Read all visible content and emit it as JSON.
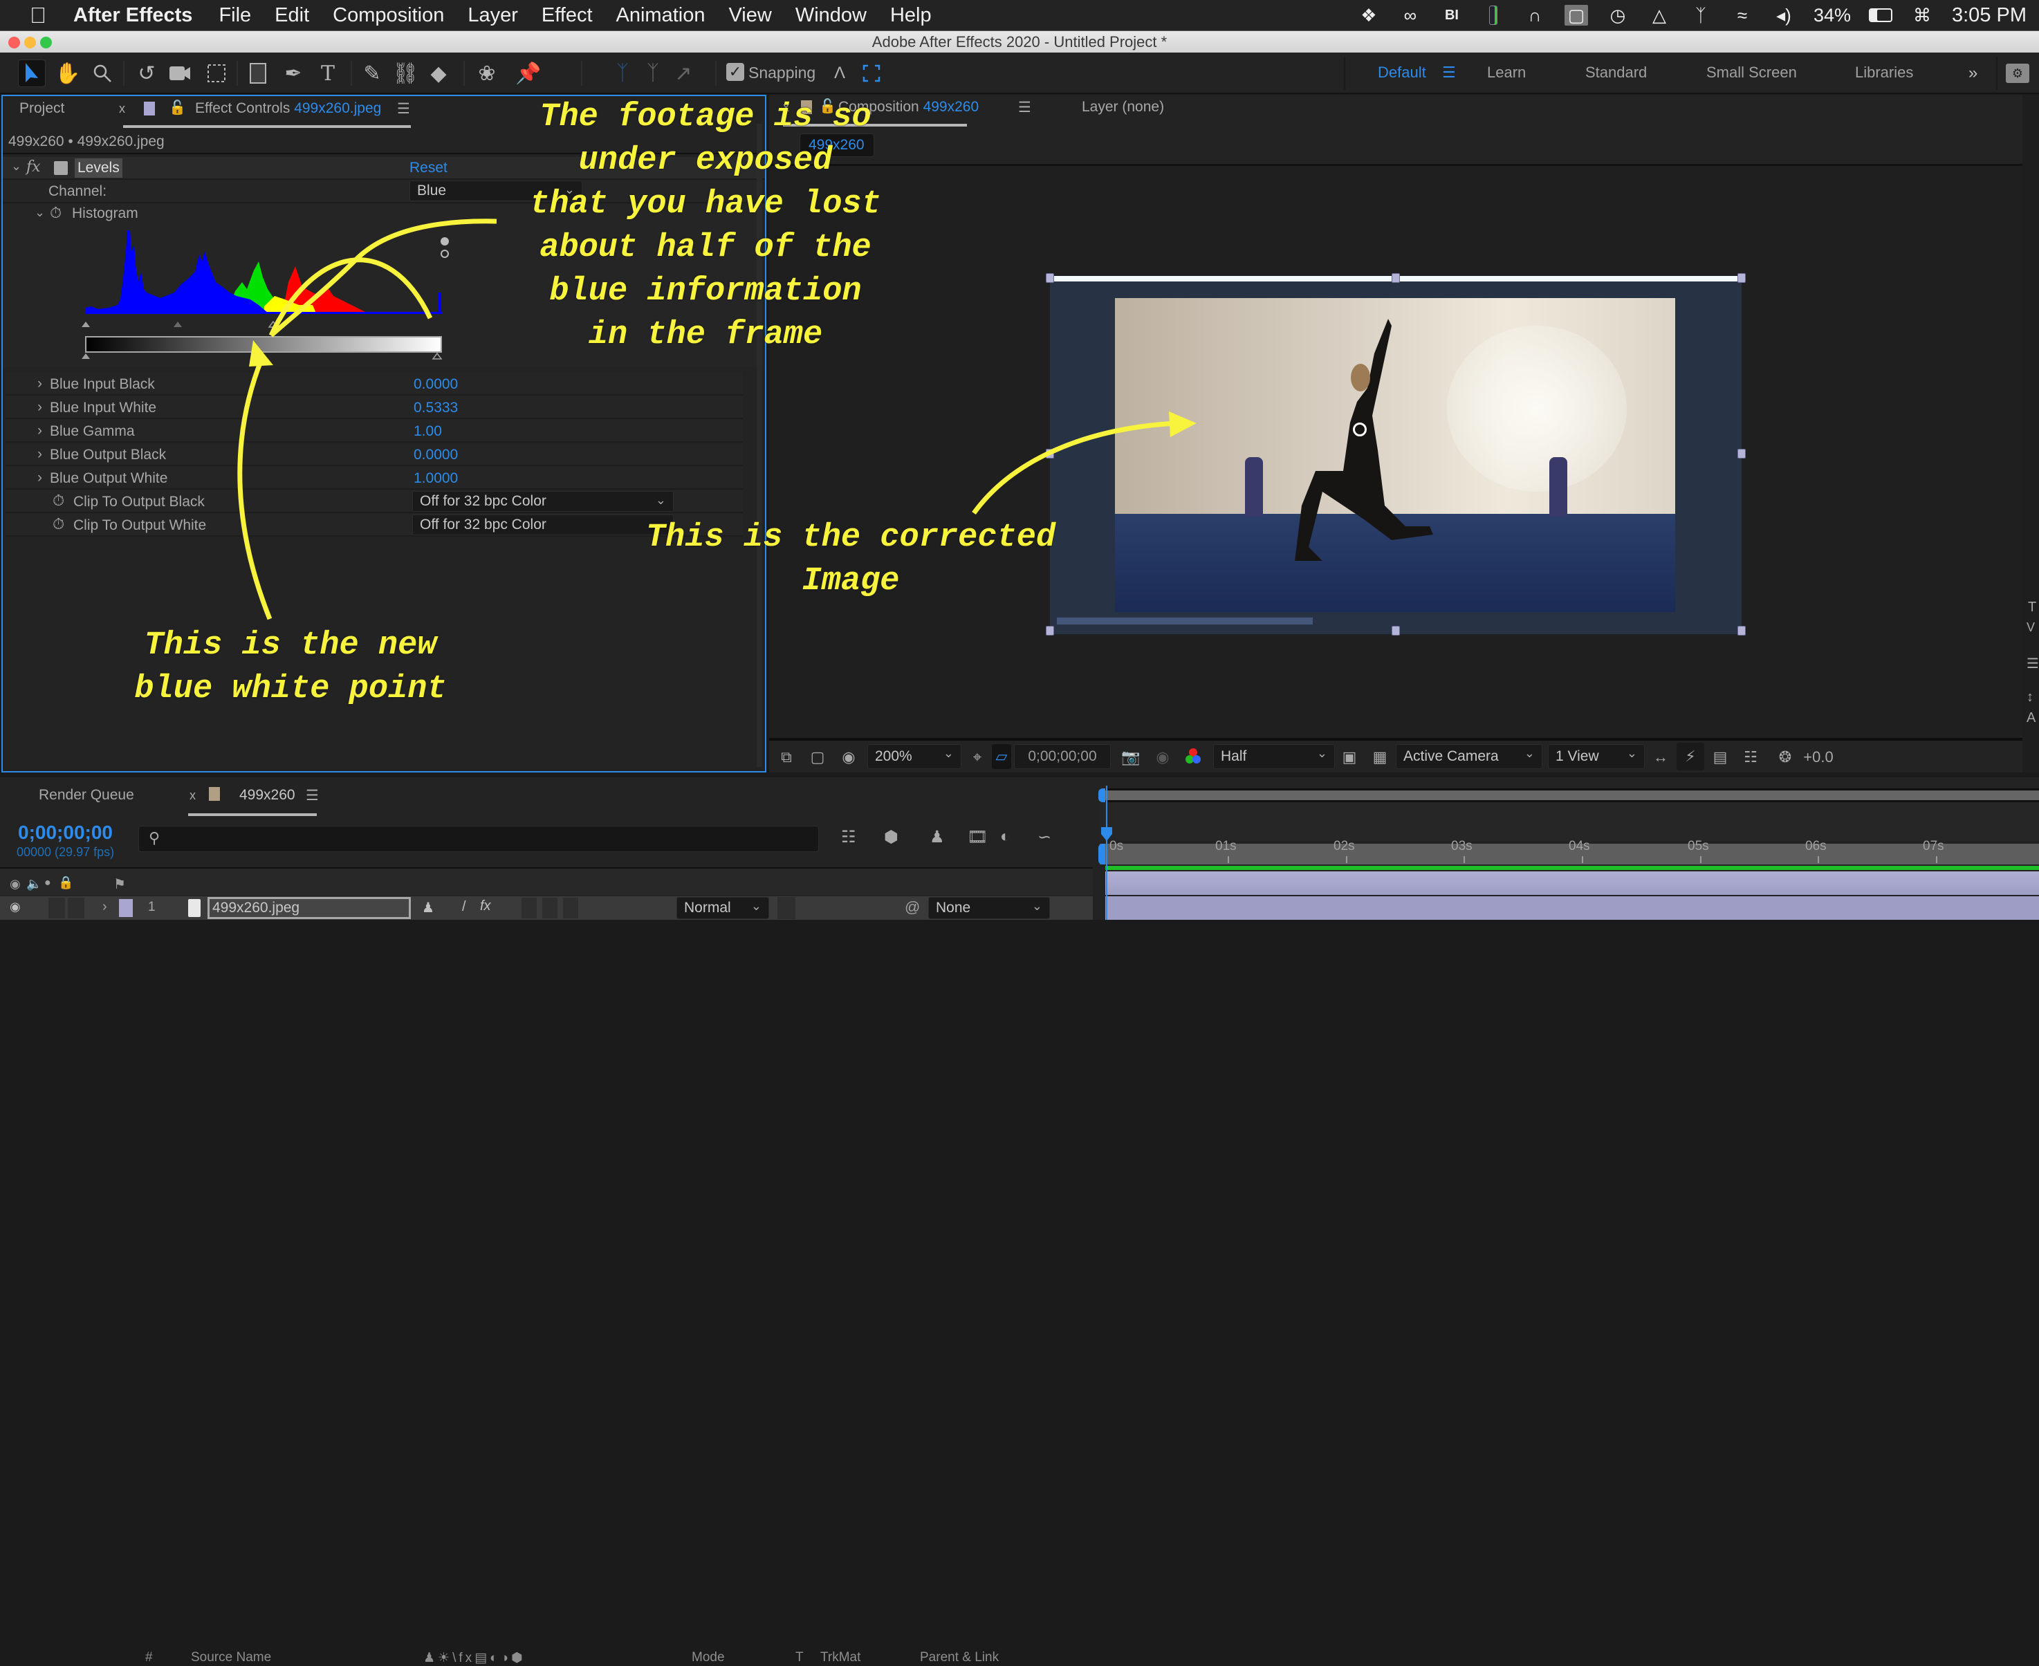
{
  "menubar": {
    "app_name": "After Effects",
    "items": [
      "File",
      "Edit",
      "Composition",
      "Layer",
      "Effect",
      "Animation",
      "View",
      "Window",
      "Help"
    ],
    "battery": "34%",
    "clock": "3:05 PM",
    "status_icons": [
      "dropbox-icon",
      "creative-cloud-icon",
      "bi-icon",
      "battery-monitor-icon",
      "app-icon",
      "display-icon",
      "time-machine-icon",
      "airplay-icon",
      "bluetooth-icon",
      "wifi-icon",
      "volume-icon",
      "battery-icon",
      "keyboard-icon"
    ]
  },
  "window": {
    "title": "Adobe After Effects 2020 - Untitled Project *"
  },
  "toolbar": {
    "tools": [
      "selection-tool",
      "hand-tool",
      "zoom-tool",
      "rotation-tool",
      "camera-tool",
      "pan-behind-tool",
      "rectangle-tool",
      "pen-tool",
      "type-tool",
      "brush-tool",
      "clone-stamp-tool",
      "eraser-tool",
      "roto-brush-tool",
      "puppet-tool"
    ],
    "snapping_label": "Snapping",
    "snapping_checked": true,
    "workspaces": {
      "active": "Default",
      "items": [
        "Learn",
        "Standard",
        "Small Screen",
        "Libraries"
      ],
      "more": "»"
    }
  },
  "effect_controls": {
    "tab_project": "Project",
    "tab_close": "x",
    "tab_prefix": "Effect Controls",
    "tab_file": "499x260.jpeg",
    "breadcrumb": "499x260 • 499x260.jpeg",
    "effect_name": "Levels",
    "fx_label": "fx",
    "reset_label": "Reset",
    "channel_label": "Channel:",
    "channel_value": "Blue",
    "histogram_label": "Histogram",
    "properties": [
      {
        "label": "Blue Input Black",
        "value": "0.0000"
      },
      {
        "label": "Blue Input White",
        "value": "0.5333"
      },
      {
        "label": "Blue Gamma",
        "value": "1.00"
      },
      {
        "label": "Blue Output Black",
        "value": "0.0000"
      },
      {
        "label": "Blue Output White",
        "value": "1.0000"
      }
    ],
    "clip_black_label": "Clip To Output Black",
    "clip_black_value": "Off for 32 bpc Color",
    "clip_white_label": "Clip To Output White",
    "clip_white_value": "Off for 32 bpc Color"
  },
  "composition": {
    "tab_prefix": "Composition",
    "tab_name": "499x260",
    "layer_tab": "Layer (none)",
    "comp_chip": "499x260",
    "viewer_toolbar": {
      "zoom": "200%",
      "timecode": "0;00;00;00",
      "resolution": "Half",
      "camera": "Active Camera",
      "views": "1 View",
      "exposure": "+0.0"
    }
  },
  "annotations": {
    "top": "The footage is so\nunder exposed\nthat you have lost\nabout half of the\nblue information\nin the frame",
    "white_point": "This is the new\nblue white point",
    "corrected": "This is the corrected\nImage"
  },
  "timeline": {
    "render_queue_tab": "Render Queue",
    "comp_tab": "499x260",
    "timecode": "0;00;00;00",
    "frame_info": "00000 (29.97 fps)",
    "search_placeholder": "",
    "columns": {
      "hash": "#",
      "source_name": "Source Name",
      "mode": "Mode",
      "t": "T",
      "trkmat": "TrkMat",
      "parent": "Parent & Link"
    },
    "ruler": [
      "0s",
      "01s",
      "02s",
      "03s",
      "04s",
      "05s",
      "06s",
      "07s"
    ],
    "layers": [
      {
        "index": "1",
        "name": "499x260.jpeg",
        "mode": "Normal",
        "parent": "None"
      }
    ]
  },
  "colors": {
    "accent": "#2d8ceb",
    "annotation": "#f8f33c",
    "layer_label": "#a9a6d1",
    "comp_label": "#b09f83"
  }
}
